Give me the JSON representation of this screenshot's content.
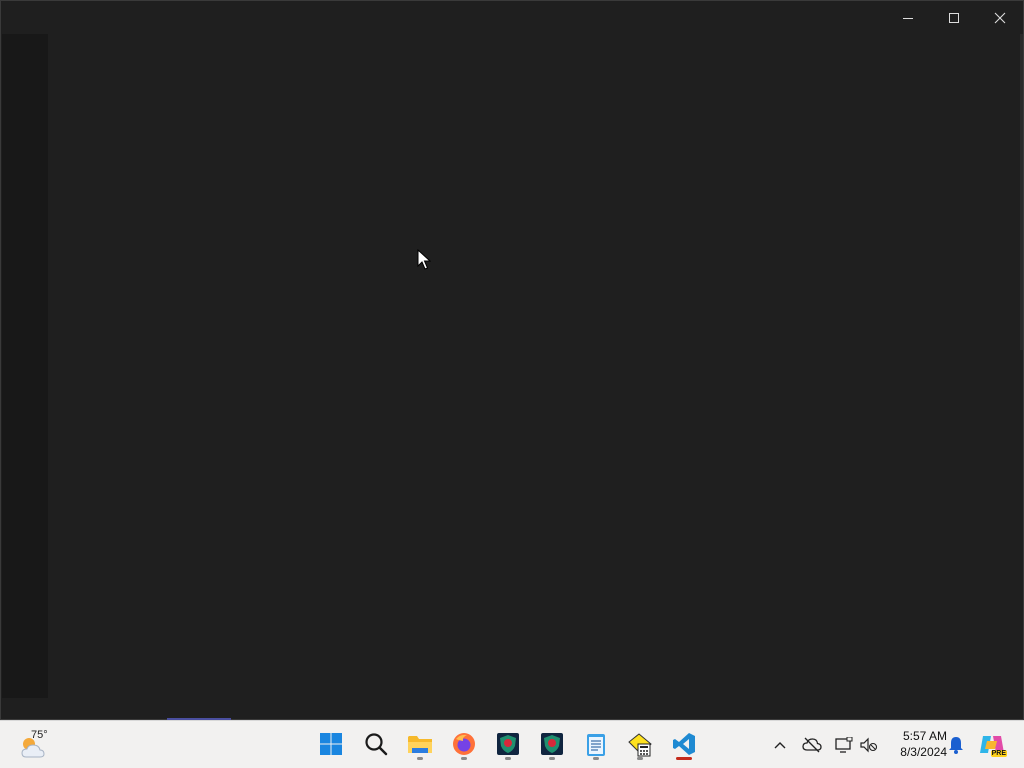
{
  "window": {
    "controls": {
      "minimize_icon": "minimize-icon",
      "maximize_icon": "maximize-icon",
      "close_icon": "close-icon"
    },
    "background_color": "#1f1f1f"
  },
  "taskbar": {
    "weather": {
      "temperature": "75°",
      "icon": "partly-cloudy-icon"
    },
    "pinned_apps": [
      {
        "name": "Start",
        "icon": "windows-start-icon"
      },
      {
        "name": "Search",
        "icon": "search-icon"
      },
      {
        "name": "File Explorer",
        "icon": "folder-icon",
        "running": true
      },
      {
        "name": "Firefox",
        "icon": "firefox-icon",
        "running": true
      },
      {
        "name": "App 1",
        "icon": "shield-app-icon",
        "running": true
      },
      {
        "name": "App 2",
        "icon": "shield-app-icon",
        "running": true
      },
      {
        "name": "Notepad",
        "icon": "notepad-icon",
        "running": true
      },
      {
        "name": "Calculator",
        "icon": "calculator-icon",
        "running": true
      },
      {
        "name": "Visual Studio Code",
        "icon": "vscode-icon",
        "running": true,
        "active": true
      }
    ],
    "tray": {
      "overflow_icon": "chevron-up-icon",
      "onedrive_icon": "cloud-offline-icon",
      "network_icon": "network-icon",
      "volume_icon": "volume-muted-icon",
      "notification_icon": "bell-icon",
      "copilot_icon": "copilot-pre-icon",
      "copilot_badge": "PRE"
    },
    "clock": {
      "time": "5:57 AM",
      "date": "8/3/2024"
    }
  }
}
